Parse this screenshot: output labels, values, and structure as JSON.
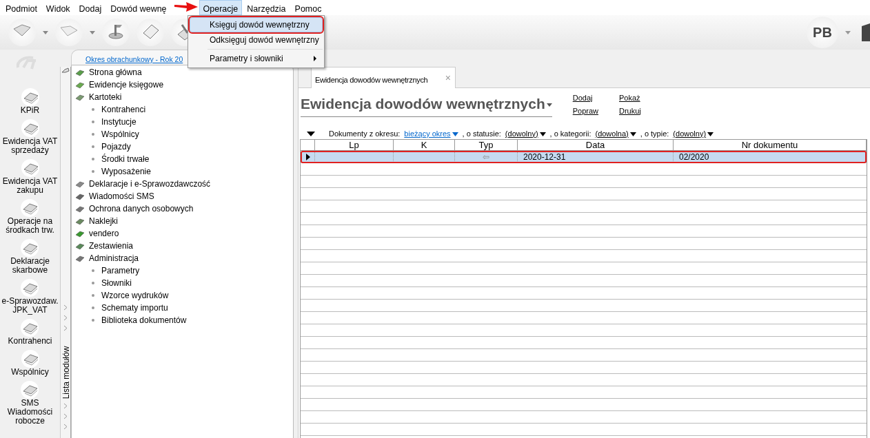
{
  "menu_bar": {
    "items": [
      {
        "label": "Podmiot",
        "selected": false
      },
      {
        "label": "Widok",
        "selected": false
      },
      {
        "label": "Dodaj",
        "selected": false
      },
      {
        "label": "Dowód wewnę",
        "selected": false
      },
      {
        "label": "Operacje",
        "selected": true
      },
      {
        "label": "Narzędzia",
        "selected": false
      },
      {
        "label": "Pomoc",
        "selected": false
      }
    ]
  },
  "dropdown": {
    "items": [
      {
        "label": "Księguj dowód wewnętrzny",
        "selected": true,
        "annotated": true,
        "submenu": false
      },
      {
        "label": "Odksięguj dowód wewnętrzny",
        "selected": false,
        "annotated": false,
        "submenu": false
      },
      {
        "label": "Parametry i słowniki",
        "selected": false,
        "annotated": false,
        "submenu": true
      }
    ]
  },
  "toolbar": {
    "user_initials": "PB"
  },
  "modules": [
    {
      "lines": [
        "KPiR"
      ]
    },
    {
      "lines": [
        "Ewidencja VAT",
        "sprzedaży"
      ]
    },
    {
      "lines": [
        "Ewidencja VAT",
        "zakupu"
      ]
    },
    {
      "lines": [
        "Operacje na",
        "środkach trw."
      ]
    },
    {
      "lines": [
        "Deklaracje",
        "skarbowe"
      ]
    },
    {
      "lines": [
        "e-Sprawozdaw.",
        "JPK_VAT"
      ]
    },
    {
      "lines": [
        "Kontrahenci"
      ]
    },
    {
      "lines": [
        "Wspólnicy"
      ]
    },
    {
      "lines": [
        "SMS",
        "Wiadomości",
        "robocze"
      ]
    }
  ],
  "module_strip": {
    "label": "Lista modułów"
  },
  "period_link": "Okres obrachunkowy - Rok 20",
  "tree": [
    {
      "label": "Strona główna"
    },
    {
      "label": "Ewidencje księgowe"
    },
    {
      "label": "Kartoteki",
      "children": [
        {
          "label": "Kontrahenci"
        },
        {
          "label": "Instytucje"
        },
        {
          "label": "Wspólnicy"
        },
        {
          "label": "Pojazdy"
        },
        {
          "label": "Środki trwałe"
        },
        {
          "label": "Wyposażenie"
        }
      ]
    },
    {
      "label": "Deklaracje i e-Sprawozdawczość"
    },
    {
      "label": "Wiadomości SMS"
    },
    {
      "label": "Ochrona danych osobowych"
    },
    {
      "label": "Naklejki"
    },
    {
      "label": "vendero"
    },
    {
      "label": "Zestawienia"
    },
    {
      "label": "Administracja",
      "children": [
        {
          "label": "Parametry"
        },
        {
          "label": "Słowniki"
        },
        {
          "label": "Wzorce wydruków"
        },
        {
          "label": "Schematy importu"
        },
        {
          "label": "Biblioteka dokumentów"
        }
      ]
    }
  ],
  "document_tab": {
    "label": "Ewidencja dowodów wewnętrznych",
    "close_symbol": "×"
  },
  "heading": "Ewidencja dowodów wewnętrznych",
  "actions": [
    [
      "Dodaj",
      "Popraw"
    ],
    [
      "Pokaż",
      "Drukuj"
    ]
  ],
  "filter": [
    {
      "kind": "text",
      "text": "Dokumenty z okresu:"
    },
    {
      "kind": "choice",
      "text": "bieżący okres",
      "color": "#0066cc"
    },
    {
      "kind": "text",
      "text": ", o statusie:"
    },
    {
      "kind": "choice",
      "text": "(dowolny)",
      "color": "#000000"
    },
    {
      "kind": "text",
      "text": ", o kategorii:"
    },
    {
      "kind": "choice",
      "text": "(dowolna)",
      "color": "#000000"
    },
    {
      "kind": "text",
      "text": ", o typie:"
    },
    {
      "kind": "choice",
      "text": "(dowolny)",
      "color": "#000000"
    }
  ],
  "table": {
    "columns": [
      "Lp",
      "K",
      "Typ",
      "Data",
      "Nr dokumentu"
    ],
    "rows": [
      {
        "cells": [
          "",
          "",
          "⇦",
          "2020-12-31",
          "02/2020"
        ],
        "selected": true,
        "annotated": true
      }
    ]
  }
}
